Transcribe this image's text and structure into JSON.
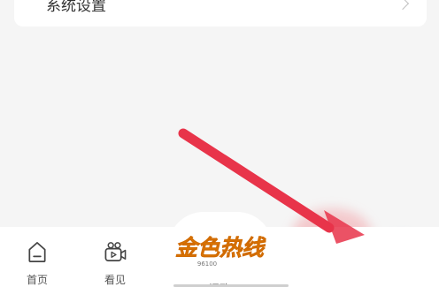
{
  "settings": {
    "system_settings_label": "系统设置"
  },
  "tabbar": {
    "home_label": "首页",
    "watch_label": "看见",
    "center_label": "问政",
    "logo_main": "金色热线",
    "logo_sub": "96100"
  },
  "icons": {
    "home": "home-icon",
    "watch": "video-camera-icon",
    "chevron": "chevron-right-icon"
  },
  "colors": {
    "accent": "#e8344a",
    "logo_orange": "#f08a00",
    "background": "#f5f5f5"
  }
}
